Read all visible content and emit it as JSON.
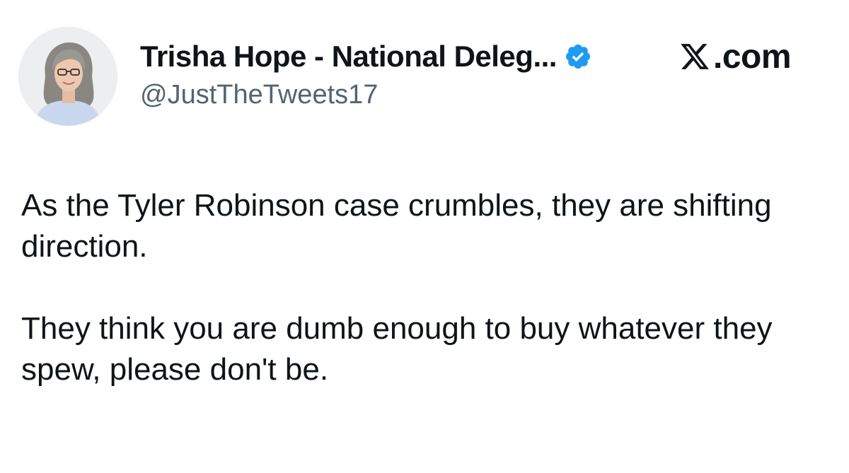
{
  "tweet": {
    "author": {
      "display_name": "Trisha Hope - National Deleg...",
      "handle": "@JustTheTweets17",
      "verified_icon": "verified-badge-icon",
      "verified_color": "#1d9bf0"
    },
    "brand": {
      "logo_icon": "x-logo-icon",
      "label": ".com"
    },
    "paragraphs": [
      "As the Tyler Robinson case crumbles, they are shifting direction.",
      "They think you are dumb enough to buy whatever they spew, please don't be."
    ]
  },
  "colors": {
    "text": "#0f1419",
    "secondary_text": "#536471",
    "accent": "#1d9bf0",
    "background": "#ffffff"
  }
}
